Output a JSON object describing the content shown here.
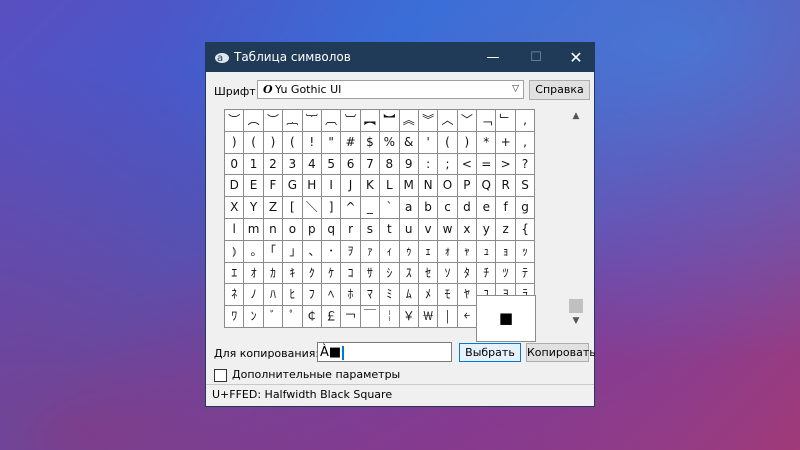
{
  "window": {
    "title": "Таблица символов",
    "min_glyph": "—",
    "max_glyph": "☐",
    "close_glyph": "✕"
  },
  "font": {
    "label": "Шрифт:",
    "icon_glyph": "O",
    "selected": "Yu Gothic UI",
    "help_label": "Справка"
  },
  "grid": {
    "rows": [
      [
        "︶",
        "︵",
        "︶",
        "︷",
        "︸",
        "︹",
        "︺",
        "︻",
        "︼",
        "︽",
        "︾",
        "︿",
        "﹀",
        "﹁",
        "﹂",
        ","
      ],
      [
        ")",
        "(",
        ")",
        "(",
        "!",
        "\"",
        "#",
        "$",
        "%",
        "&",
        "'",
        "(",
        ")",
        "*",
        "+",
        ","
      ],
      [
        "0",
        "1",
        "2",
        "3",
        "4",
        "5",
        "6",
        "7",
        "8",
        "9",
        ":",
        ";",
        "<",
        "=",
        ">",
        "?"
      ],
      [
        "D",
        "E",
        "F",
        "G",
        "H",
        "I",
        "J",
        "K",
        "L",
        "M",
        "N",
        "O",
        "P",
        "Q",
        "R",
        "S"
      ],
      [
        "X",
        "Y",
        "Z",
        "[",
        "＼",
        "]",
        "^",
        "_",
        "`",
        "a",
        "b",
        "c",
        "d",
        "e",
        "f",
        "g"
      ],
      [
        "l",
        "m",
        "n",
        "o",
        "p",
        "q",
        "r",
        "s",
        "t",
        "u",
        "v",
        "w",
        "x",
        "y",
        "z",
        "{"
      ],
      [
        "⦆",
        "｡",
        "｢",
        "｣",
        "､",
        "･",
        "ｦ",
        "ｧ",
        "ｨ",
        "ｩ",
        "ｪ",
        "ｫ",
        "ｬ",
        "ｭ",
        "ｮ",
        "ｯ"
      ],
      [
        "ｴ",
        "ｵ",
        "ｶ",
        "ｷ",
        "ｸ",
        "ｹ",
        "ｺ",
        "ｻ",
        "ｼ",
        "ｽ",
        "ｾ",
        "ｿ",
        "ﾀ",
        "ﾁ",
        "ﾂ",
        "ﾃ"
      ],
      [
        "ﾈ",
        "ﾉ",
        "ﾊ",
        "ﾋ",
        "ﾌ",
        "ﾍ",
        "ﾎ",
        "ﾏ",
        "ﾐ",
        "ﾑ",
        "ﾒ",
        "ﾓ",
        "ﾔ",
        "ﾕ",
        "ﾖ",
        "ﾗ"
      ],
      [
        "ﾜ",
        "ﾝ",
        "ﾞ",
        "ﾟ",
        "￠",
        "￡",
        "￢",
        "￣",
        "￤",
        "￥",
        "￦",
        "￨",
        "￩",
        "￪",
        "￫",
        "￬"
      ]
    ]
  },
  "popup": {
    "glyph": "■"
  },
  "copy": {
    "label": "Для копирования:",
    "value": "À■",
    "select_label": "Выбрать",
    "copy_label": "Копировать"
  },
  "advanced": {
    "label": "Дополнительные параметры"
  },
  "status": {
    "text": "U+FFED: Halfwidth Black Square"
  },
  "scroll": {
    "up_glyph": "▲",
    "down_glyph": "▼"
  }
}
